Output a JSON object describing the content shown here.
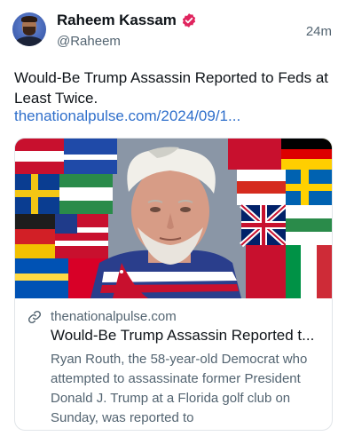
{
  "post": {
    "author_name": "Raheem Kassam",
    "handle": "@Raheem",
    "timestamp": "24m",
    "text": "Would-Be Trump Assassin Reported to Feds at Least Twice.",
    "link_text": "thenationalpulse.com/2024/09/1..."
  },
  "card": {
    "domain": "thenationalpulse.com",
    "title": "Would-Be Trump Assassin Reported t...",
    "description": "Ryan Routh, the 58-year-old Democrat who attempted to assassinate former President Donald J. Trump at a Florida golf club on Sunday, was reported to"
  },
  "icons": {
    "verified": "verified-badge-icon",
    "link": "link-icon"
  },
  "colors": {
    "verified_badge": "#e0245e",
    "link": "#2f6fcb",
    "secondary_text": "#536471",
    "card_border": "#e1e5e9"
  }
}
